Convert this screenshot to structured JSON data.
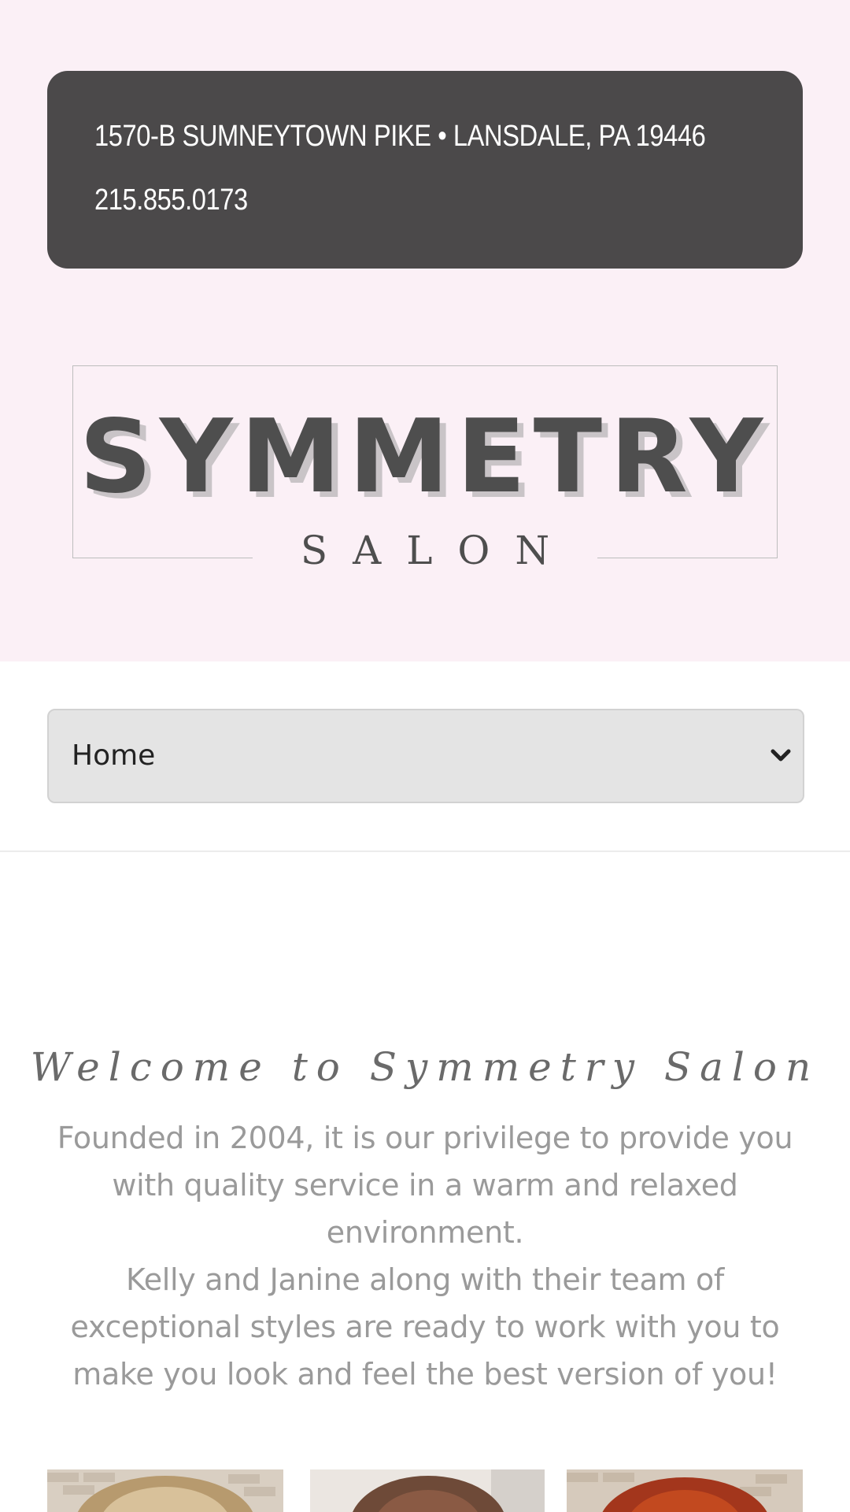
{
  "header": {
    "address": "1570-B SUMNEYTOWN PIKE • LANSDALE, PA 19446",
    "phone": "215.855.0173"
  },
  "logo": {
    "wordmark": "SYMMETRY",
    "subtitle": "SALON"
  },
  "nav": {
    "selected": "Home"
  },
  "welcome": {
    "title": "Welcome to Symmetry Salon",
    "paragraph_1": "Founded in 2004, it is our privilege to provide you with quality service in a warm and relaxed environment.",
    "paragraph_2": "Kelly and Janine along with their team of exceptional styles are ready to work with you to make you look and feel the best version of you!"
  },
  "gallery": {
    "items": [
      {
        "subject": "blonde-highlights-hair-photo"
      },
      {
        "subject": "brunette-hair-photo"
      },
      {
        "subject": "red-hair-photo"
      }
    ]
  },
  "colors": {
    "top_background": "#fbf0f6",
    "contact_box": "#4b494a",
    "logo_text": "#4e4e4e",
    "logo_shadow": "#c9c4c7",
    "select_background": "#e4e4e4",
    "body_text": "#9a9a9a",
    "title_text": "#6a6a6a"
  },
  "icons": {
    "nav_chevron": "chevron-down-icon"
  }
}
